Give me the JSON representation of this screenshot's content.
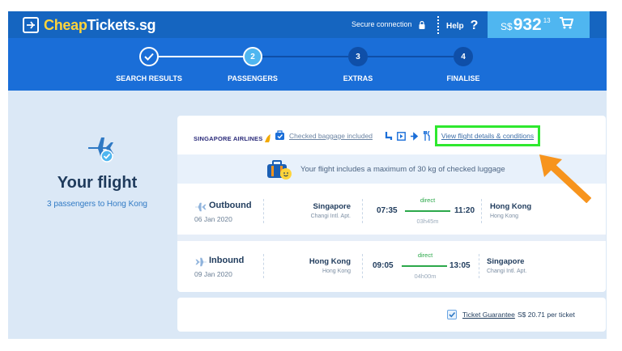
{
  "brand": {
    "name_part1": "Cheap",
    "name_part2": "Tickets.sg"
  },
  "header": {
    "secure_text": "Secure connection",
    "help_label": "Help",
    "help_icon": "?",
    "price": {
      "currency": "S$",
      "amount": "932",
      "decimals": "13"
    }
  },
  "steps": [
    {
      "number": "✓",
      "label": "SEARCH RESULTS",
      "state": "done"
    },
    {
      "number": "2",
      "label": "PASSENGERS",
      "state": "current"
    },
    {
      "number": "3",
      "label": "EXTRAS",
      "state": "upcoming"
    },
    {
      "number": "4",
      "label": "FINALISE",
      "state": "upcoming"
    }
  ],
  "summary": {
    "title": "Your flight",
    "subtitle": "3 passengers to Hong Kong"
  },
  "card": {
    "airline": "SINGAPORE AIRLINES",
    "baggage_link": "Checked baggage included",
    "amenities": [
      "seat-icon",
      "screen-icon",
      "power-icon",
      "meal-icon"
    ],
    "details_link": "View flight details & conditions",
    "luggage_note": "Your flight includes a maximum of 30 kg of checked luggage"
  },
  "flights": [
    {
      "direction": "Outbound",
      "date": "06 Jan 2020",
      "from_city": "Singapore",
      "from_airport": "Changi Intl. Apt.",
      "dep": "07:35",
      "stops": "direct",
      "duration": "03h45m",
      "arr": "11:20",
      "to_city": "Hong Kong",
      "to_airport": "Hong Kong"
    },
    {
      "direction": "Inbound",
      "date": "09 Jan 2020",
      "from_city": "Hong Kong",
      "from_airport": "Hong Kong",
      "dep": "09:05",
      "stops": "direct",
      "duration": "04h00m",
      "arr": "13:05",
      "to_city": "Singapore",
      "to_airport": "Changi Intl. Apt."
    }
  ],
  "guarantee": {
    "label": "Ticket Guarantee",
    "price": "S$ 20.71 per ticket",
    "checked": true
  },
  "colors": {
    "primary": "#1565c0",
    "accent": "#4fb6f0",
    "highlight": "#2ee82e",
    "arrow": "#f7941d",
    "direct": "#2ba84a"
  }
}
